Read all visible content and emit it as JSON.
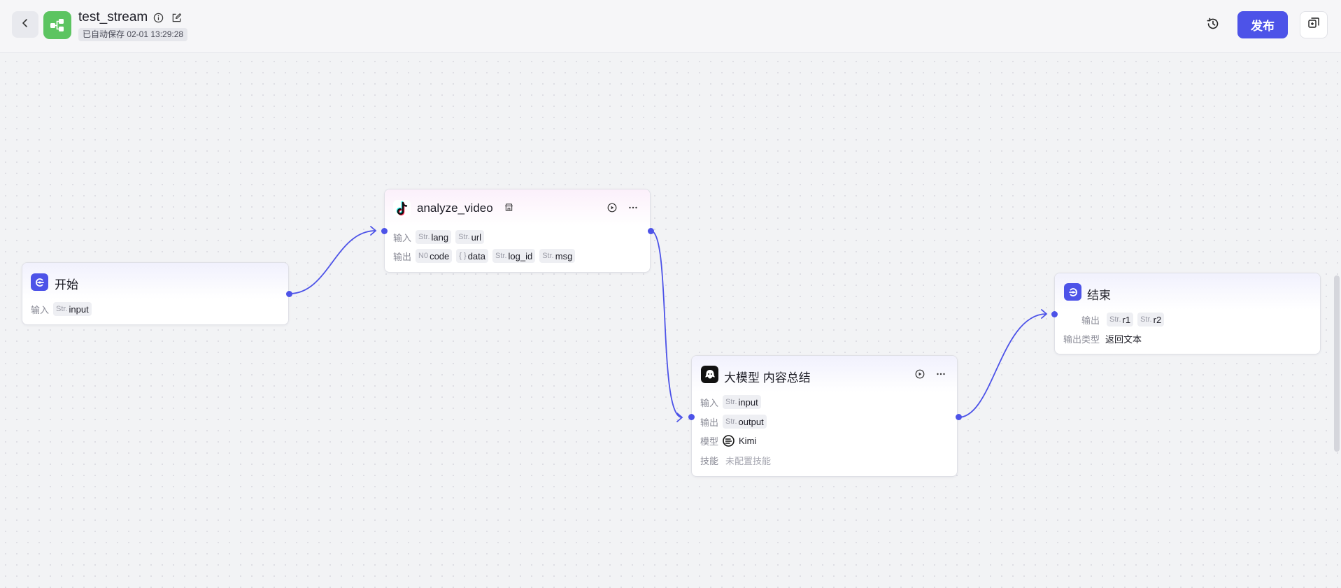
{
  "header": {
    "title": "test_stream",
    "autosave": "已自动保存 02-01 13:29:28",
    "publish_label": "发布"
  },
  "colors": {
    "accent": "#4d53e8",
    "app_icon_bg": "#5cc461",
    "edge": "#4d53e8"
  },
  "nodes": {
    "start": {
      "title": "开始",
      "input_label": "输入",
      "inputs": [
        {
          "type": "Str.",
          "name": "input"
        }
      ]
    },
    "analyze": {
      "title": "analyze_video",
      "input_label": "输入",
      "output_label": "输出",
      "inputs": [
        {
          "type": "Str.",
          "name": "lang"
        },
        {
          "type": "Str.",
          "name": "url"
        }
      ],
      "outputs": [
        {
          "type": "N0",
          "name": "code"
        },
        {
          "type": "{ }",
          "name": "data"
        },
        {
          "type": "Str.",
          "name": "log_id"
        },
        {
          "type": "Str.",
          "name": "msg"
        }
      ]
    },
    "llm": {
      "title": "大模型 内容总结",
      "input_label": "输入",
      "output_label": "输出",
      "model_label": "模型",
      "skill_label": "技能",
      "inputs": [
        {
          "type": "Str.",
          "name": "input"
        }
      ],
      "outputs": [
        {
          "type": "Str.",
          "name": "output"
        }
      ],
      "model": "Kimi",
      "skills": "未配置技能"
    },
    "end": {
      "title": "结束",
      "output_label": "输出",
      "output_type_label": "输出类型",
      "outputs": [
        {
          "type": "Str.",
          "name": "r1"
        },
        {
          "type": "Str.",
          "name": "r2"
        }
      ],
      "output_type": "返回文本"
    }
  },
  "icons": {
    "back": "chevron-left-icon",
    "app": "workflow-icon",
    "info": "info-icon",
    "edit": "edit-icon",
    "history": "history-icon",
    "copy": "copy-icon",
    "run": "play-circle-icon",
    "more": "more-icon",
    "start": "start-icon",
    "end": "end-icon",
    "tiktok": "tiktok-icon",
    "llm": "llm-icon",
    "kimi": "kimi-icon"
  }
}
